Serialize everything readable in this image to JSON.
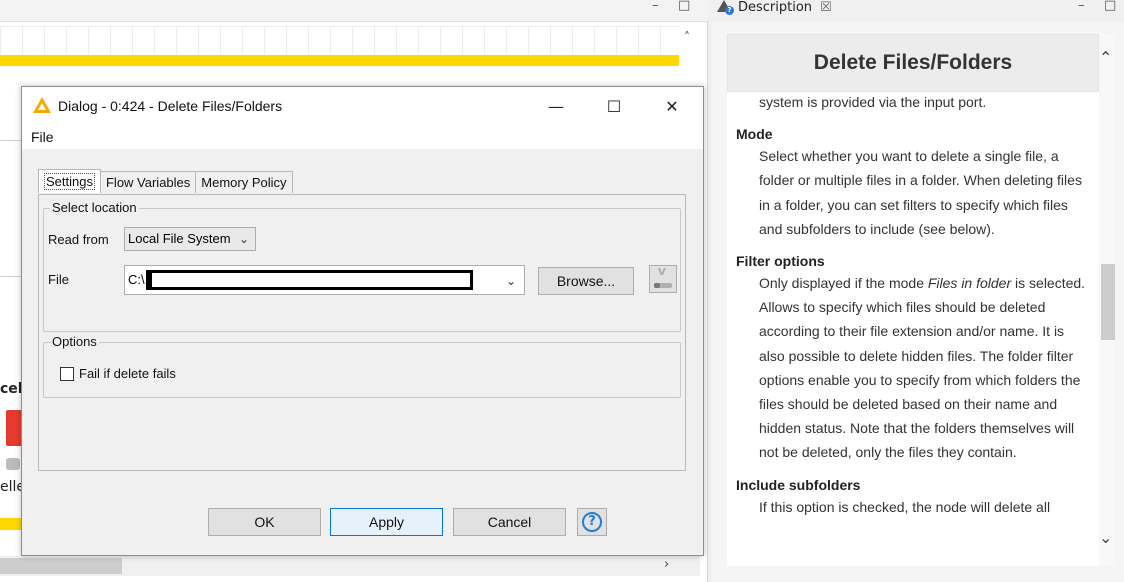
{
  "editor": {
    "fragment_cancel": "cel",
    "fragment_cancelled": "elle"
  },
  "description": {
    "tab_label": "Description",
    "title": "Delete Files/Folders",
    "intro_tail": "system is provided via the input port.",
    "sections": [
      {
        "heading": "Mode",
        "text": "Select whether you want to delete a single file, a folder or multiple files in a folder. When deleting files in a folder, you can set filters to specify which files and subfolders to include (see below)."
      },
      {
        "heading": "Filter options",
        "text_pre": "Only displayed if the mode ",
        "text_em": "Files in folder",
        "text_post": " is selected. Allows to specify which files should be deleted according to their file extension and/or name. It is also possible to delete hidden files. The folder filter options enable you to specify from which folders the files should be deleted based on their name and hidden status. Note that the folders themselves will not be deleted, only the files they contain."
      },
      {
        "heading": "Include subfolders",
        "text": "If this option is checked, the node will delete all"
      }
    ]
  },
  "dialog": {
    "title": "Dialog - 0:424 - Delete Files/Folders",
    "menu": [
      "File"
    ],
    "tabs": [
      "Settings",
      "Flow Variables",
      "Memory Policy"
    ],
    "active_tab": "Settings",
    "select_location": {
      "group_label": "Select location",
      "read_from_label": "Read from",
      "read_from_value": "Local File System",
      "file_label": "File",
      "file_value": "C:\\",
      "browse_label": "Browse..."
    },
    "options": {
      "group_label": "Options",
      "fail_if_delete_fails_label": "Fail if delete fails",
      "fail_if_delete_fails_checked": false
    },
    "buttons": {
      "ok": "OK",
      "apply": "Apply",
      "cancel": "Cancel"
    }
  },
  "colors": {
    "accent_yellow": "#ffd800",
    "node_red": "#e63a2e",
    "default_button_border": "#0078d7",
    "help_blue": "#1f7ed6"
  }
}
